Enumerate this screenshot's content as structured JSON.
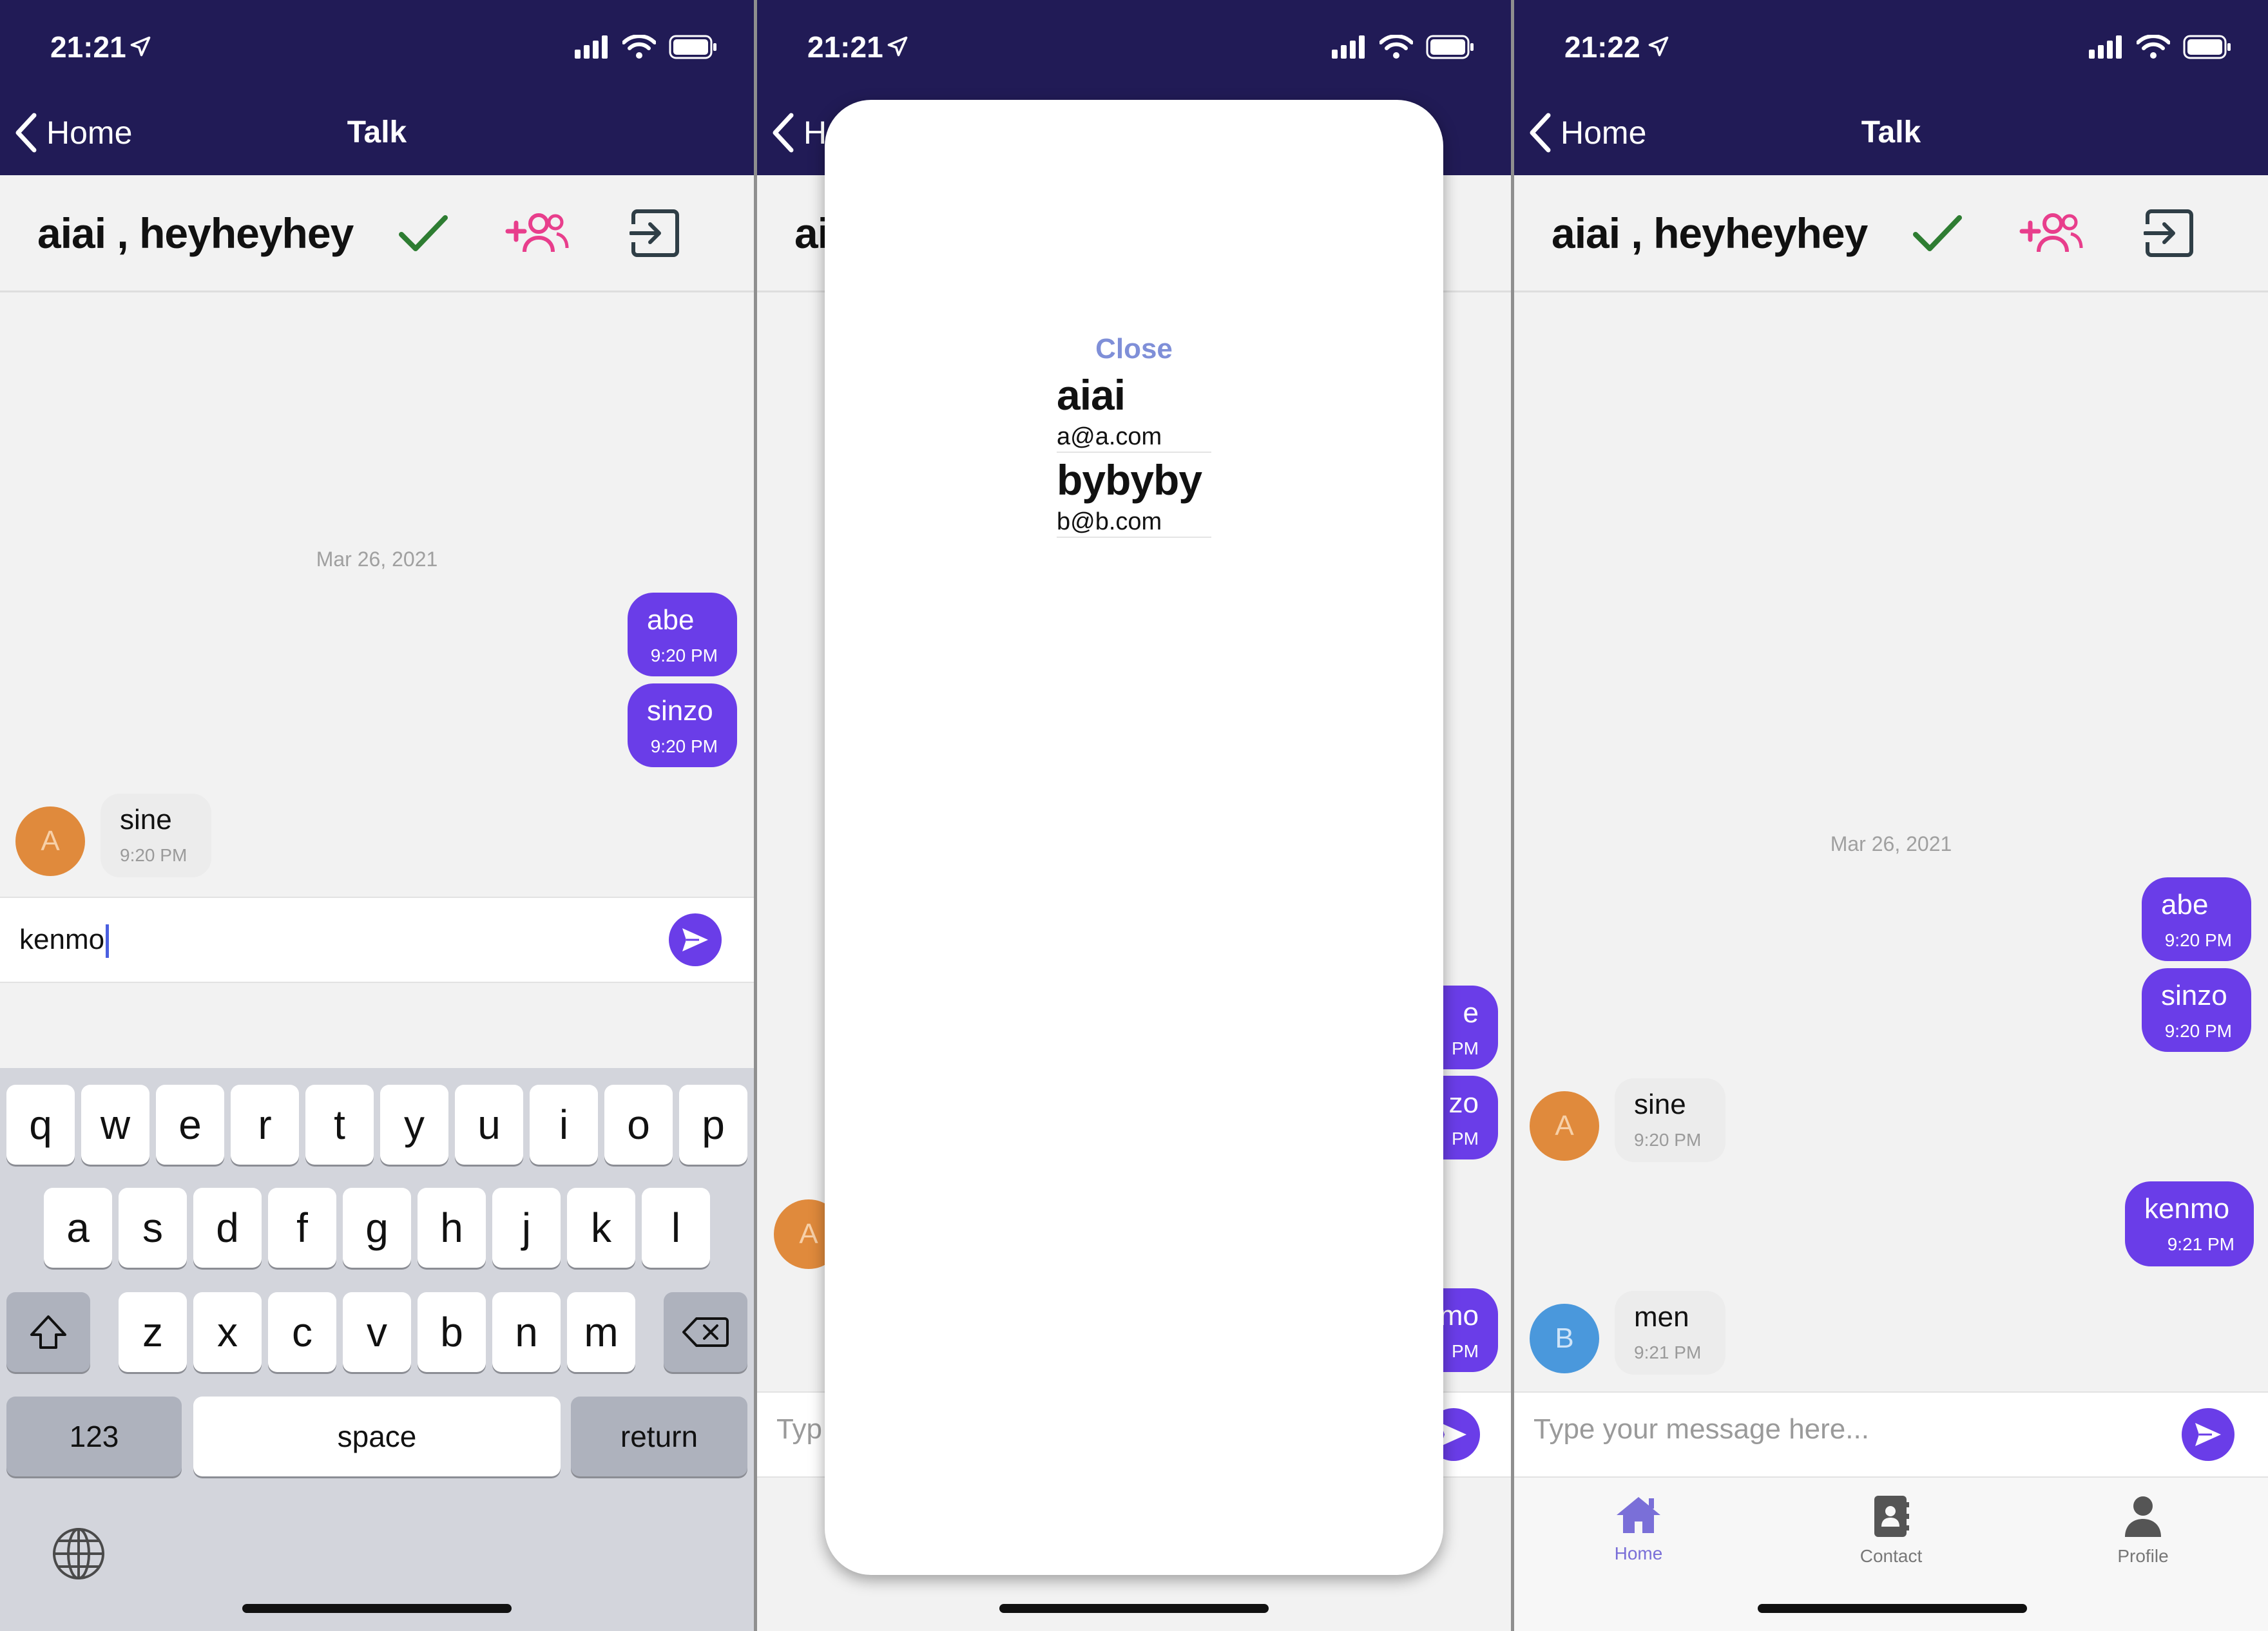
{
  "status": {
    "time_1": "21:21",
    "time_2": "21:21",
    "time_3": "21:22"
  },
  "nav": {
    "back_label": "Home",
    "back_label_partial": "H",
    "title": "Talk"
  },
  "chat": {
    "title": "aiai , heyheyhey",
    "title_partial": "ai",
    "date": "Mar 26, 2021",
    "messages": {
      "abe": {
        "text": "abe",
        "time": "9:20 PM"
      },
      "sinzo": {
        "text": "sinzo",
        "time": "9:20 PM"
      },
      "sine": {
        "text": "sine",
        "time": "9:20 PM",
        "avatar": "A"
      },
      "kenmo": {
        "text": "kenmo",
        "time": "9:21 PM"
      },
      "men": {
        "text": "men",
        "time": "9:21 PM",
        "avatar": "B"
      }
    },
    "partials": {
      "bubble_a": "e",
      "bubble_b": "zo",
      "bubble_c": "mo",
      "time_pm": "PM",
      "avatar": "A",
      "placeholder": "Typ"
    }
  },
  "composer": {
    "draft_value": "kenmo",
    "placeholder": "Type your message here..."
  },
  "keyboard": {
    "row1": [
      "q",
      "w",
      "e",
      "r",
      "t",
      "y",
      "u",
      "i",
      "o",
      "p"
    ],
    "row2": [
      "a",
      "s",
      "d",
      "f",
      "g",
      "h",
      "j",
      "k",
      "l"
    ],
    "row3": [
      "z",
      "x",
      "c",
      "v",
      "b",
      "n",
      "m"
    ],
    "numbers": "123",
    "space": "space",
    "return": "return"
  },
  "modal": {
    "close_label": "Close",
    "members": [
      {
        "name": "aiai",
        "email": "a@a.com"
      },
      {
        "name": "bybyby",
        "email": "b@b.com"
      }
    ]
  },
  "tabbar": {
    "items": [
      {
        "label": "Home",
        "icon": "home-icon"
      },
      {
        "label": "Contact",
        "icon": "contact-book-icon"
      },
      {
        "label": "Profile",
        "icon": "person-icon"
      }
    ]
  },
  "colors": {
    "navbar": "#211b56",
    "accent": "#6a3de8",
    "confirm": "#2e7d32",
    "add_member": "#e83e8c",
    "close_link": "#7f8fd8"
  }
}
